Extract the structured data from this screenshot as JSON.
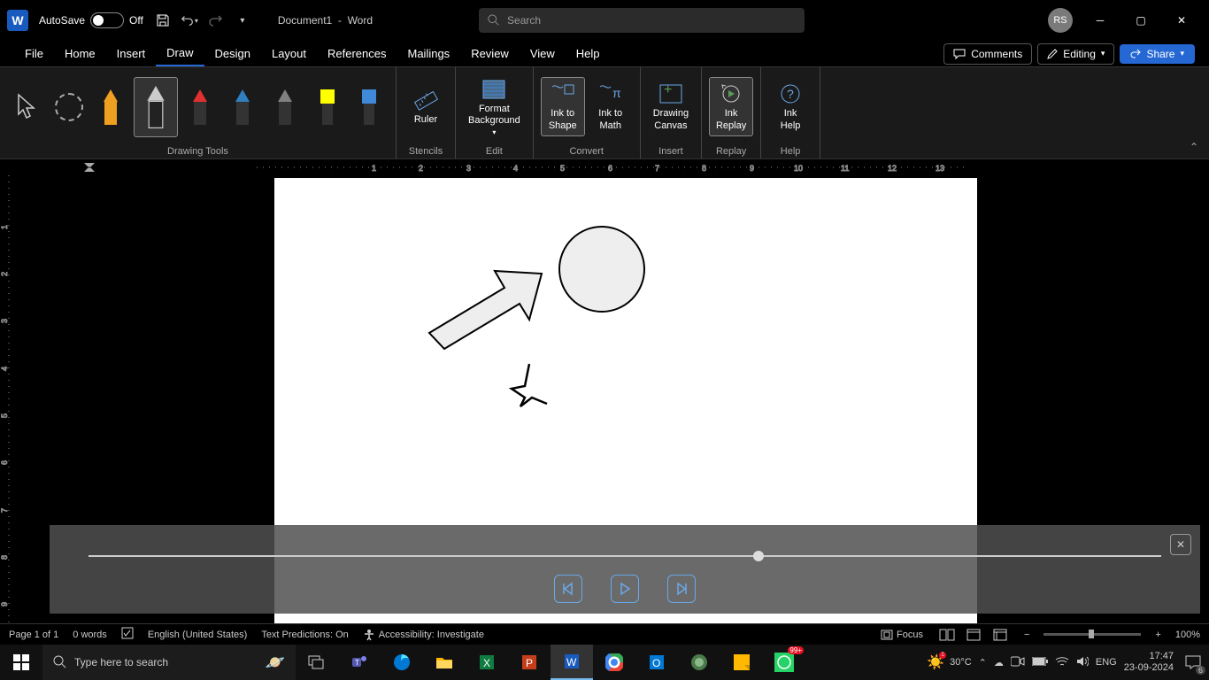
{
  "titlebar": {
    "autosave_label": "AutoSave",
    "autosave_state": "Off",
    "doc_name": "Document1",
    "app_name": "Word",
    "search_placeholder": "Search",
    "user_initials": "RS"
  },
  "tabs": {
    "file": "File",
    "home": "Home",
    "insert": "Insert",
    "draw": "Draw",
    "design": "Design",
    "layout": "Layout",
    "references": "References",
    "mailings": "Mailings",
    "review": "Review",
    "view": "View",
    "help": "Help",
    "comments": "Comments",
    "editing": "Editing",
    "share": "Share"
  },
  "ribbon": {
    "groups": {
      "drawing_tools": "Drawing Tools",
      "stencils": "Stencils",
      "edit": "Edit",
      "convert": "Convert",
      "insert": "Insert",
      "replay": "Replay",
      "help": "Help"
    },
    "buttons": {
      "ruler": "Ruler",
      "format_bg": "Format\nBackground",
      "ink_to_shape": "Ink to\nShape",
      "ink_to_math": "Ink to\nMath",
      "drawing_canvas": "Drawing\nCanvas",
      "ink_replay": "Ink\nReplay",
      "ink_help": "Ink\nHelp"
    },
    "pens": [
      {
        "color": "#f0a020"
      },
      {
        "color": "#000000"
      },
      {
        "color": "#e03030"
      },
      {
        "color": "#3080c0"
      },
      {
        "color": "#808080"
      }
    ],
    "highlighters": [
      {
        "color": "#ffff00"
      },
      {
        "color": "#4088d8"
      }
    ]
  },
  "statusbar": {
    "page": "Page 1 of 1",
    "words": "0 words",
    "language": "English (United States)",
    "predictions": "Text Predictions: On",
    "accessibility": "Accessibility: Investigate",
    "focus": "Focus",
    "zoom": "100%"
  },
  "taskbar": {
    "search_placeholder": "Type here to search",
    "temperature": "30°C",
    "lang": "ENG",
    "time": "17:47",
    "date": "23-09-2024",
    "whatsapp_badge": "99+",
    "notif_count": "6"
  },
  "drawing": {
    "shapes": [
      "arrow",
      "circle",
      "partial-star"
    ]
  }
}
